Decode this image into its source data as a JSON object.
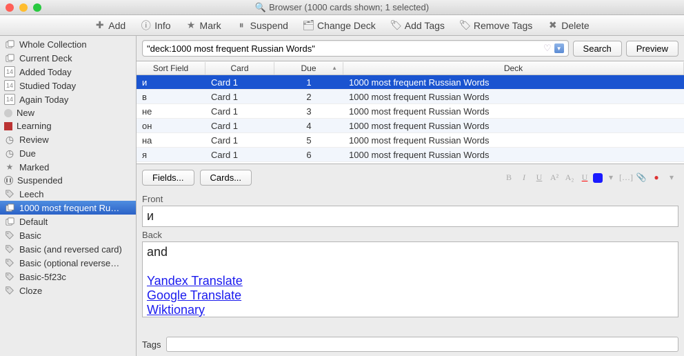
{
  "window": {
    "title": "Browser (1000 cards shown; 1 selected)"
  },
  "toolbar": {
    "add": "Add",
    "info": "Info",
    "mark": "Mark",
    "suspend": "Suspend",
    "change_deck": "Change Deck",
    "add_tags": "Add Tags",
    "remove_tags": "Remove Tags",
    "delete": "Delete"
  },
  "sidebar": {
    "items": [
      {
        "label": "Whole Collection",
        "icon": "cards"
      },
      {
        "label": "Current Deck",
        "icon": "cards"
      },
      {
        "label": "Added Today",
        "icon": "box",
        "box": "14"
      },
      {
        "label": "Studied Today",
        "icon": "box",
        "box": "14"
      },
      {
        "label": "Again Today",
        "icon": "box",
        "box": "14"
      },
      {
        "label": "New",
        "icon": "dot"
      },
      {
        "label": "Learning",
        "icon": "square-red"
      },
      {
        "label": "Review",
        "icon": "clock"
      },
      {
        "label": "Due",
        "icon": "clock"
      },
      {
        "label": "Marked",
        "icon": "star"
      },
      {
        "label": "Suspended",
        "icon": "pause"
      },
      {
        "label": "Leech",
        "icon": "tag"
      },
      {
        "label": "1000 most frequent Ru…",
        "icon": "cards",
        "selected": true
      },
      {
        "label": "Default",
        "icon": "cards"
      },
      {
        "label": "Basic",
        "icon": "tag"
      },
      {
        "label": "Basic (and reversed card)",
        "icon": "tag"
      },
      {
        "label": "Basic (optional reverse…",
        "icon": "tag"
      },
      {
        "label": "Basic-5f23c",
        "icon": "tag"
      },
      {
        "label": "Cloze",
        "icon": "tag"
      }
    ]
  },
  "search": {
    "value": "\"deck:1000 most frequent Russian Words\"",
    "search_btn": "Search",
    "preview_btn": "Preview"
  },
  "table": {
    "headers": [
      "Sort Field",
      "Card",
      "Due",
      "Deck"
    ],
    "sort_col": 2,
    "rows": [
      {
        "sort": "и",
        "card": "Card 1",
        "due": "1",
        "deck": "1000 most frequent Russian Words",
        "selected": true
      },
      {
        "sort": "в",
        "card": "Card 1",
        "due": "2",
        "deck": "1000 most frequent Russian Words"
      },
      {
        "sort": "не",
        "card": "Card 1",
        "due": "3",
        "deck": "1000 most frequent Russian Words"
      },
      {
        "sort": "он",
        "card": "Card 1",
        "due": "4",
        "deck": "1000 most frequent Russian Words"
      },
      {
        "sort": "на",
        "card": "Card 1",
        "due": "5",
        "deck": "1000 most frequent Russian Words"
      },
      {
        "sort": "я",
        "card": "Card 1",
        "due": "6",
        "deck": "1000 most frequent Russian Words"
      }
    ]
  },
  "editbar": {
    "fields_btn": "Fields...",
    "cards_btn": "Cards..."
  },
  "editor": {
    "front_label": "Front",
    "front_value": "и",
    "back_label": "Back",
    "back_value": "and",
    "back_links": [
      "Yandex Translate",
      "Google Translate",
      "Wiktionary"
    ]
  },
  "tags": {
    "label": "Tags",
    "value": ""
  }
}
